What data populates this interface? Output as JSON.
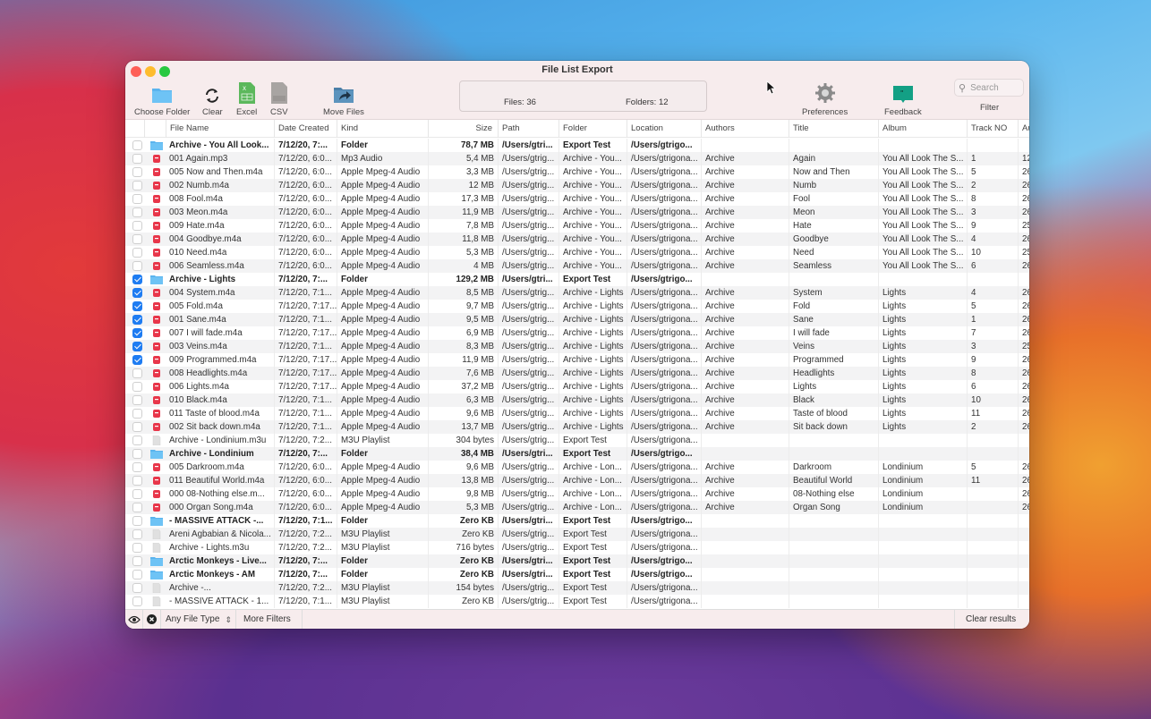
{
  "window": {
    "title": "File List Export"
  },
  "toolbar": {
    "choose_folder": "Choose Folder",
    "clear": "Clear",
    "excel": "Excel",
    "csv": "CSV",
    "csv_icon_text": "CSV",
    "move_files": "Move Files",
    "preferences": "Preferences",
    "feedback": "Feedback",
    "filter": "Filter",
    "search_placeholder": "Search"
  },
  "summary": {
    "files": "Files: 36",
    "folders": "Folders: 12"
  },
  "columns": [
    "",
    "",
    "File Name",
    "Date Created",
    "Kind",
    "Size",
    "Path",
    "Folder",
    "Location",
    "Authors",
    "Title",
    "Album",
    "Track NO",
    "Au"
  ],
  "rows": [
    {
      "checked": false,
      "type": "folder",
      "bold": true,
      "name": "Archive - You All Look...",
      "date": "7/12/20, 7:...",
      "kind": "Folder",
      "size": "78,7 MB",
      "path": "/Users/gtri...",
      "folder": "Export Test",
      "location": "/Users/gtrigo...",
      "authors": "",
      "title": "",
      "album": "",
      "track": "",
      "au": ""
    },
    {
      "checked": false,
      "type": "audio",
      "bold": false,
      "name": "001 Again.mp3",
      "date": "7/12/20, 6:0...",
      "kind": "Mp3 Audio",
      "size": "5,4 MB",
      "path": "/Users/gtrig...",
      "folder": "Archive - You...",
      "location": "/Users/gtrigona...",
      "authors": "Archive",
      "title": "Again",
      "album": "You All Look The S...",
      "track": "1",
      "au": "12"
    },
    {
      "checked": false,
      "type": "audio",
      "bold": false,
      "name": "005 Now and Then.m4a",
      "date": "7/12/20, 6:0...",
      "kind": "Apple Mpeg-4 Audio",
      "size": "3,3 MB",
      "path": "/Users/gtrig...",
      "folder": "Archive - You...",
      "location": "/Users/gtrigona...",
      "authors": "Archive",
      "title": "Now and Then",
      "album": "You All Look The S...",
      "track": "5",
      "au": "26"
    },
    {
      "checked": false,
      "type": "audio",
      "bold": false,
      "name": "002 Numb.m4a",
      "date": "7/12/20, 6:0...",
      "kind": "Apple Mpeg-4 Audio",
      "size": "12 MB",
      "path": "/Users/gtrig...",
      "folder": "Archive - You...",
      "location": "/Users/gtrigona...",
      "authors": "Archive",
      "title": "Numb",
      "album": "You All Look The S...",
      "track": "2",
      "au": "26"
    },
    {
      "checked": false,
      "type": "audio",
      "bold": false,
      "name": "008 Fool.m4a",
      "date": "7/12/20, 6:0...",
      "kind": "Apple Mpeg-4 Audio",
      "size": "17,3 MB",
      "path": "/Users/gtrig...",
      "folder": "Archive - You...",
      "location": "/Users/gtrigona...",
      "authors": "Archive",
      "title": "Fool",
      "album": "You All Look The S...",
      "track": "8",
      "au": "26"
    },
    {
      "checked": false,
      "type": "audio",
      "bold": false,
      "name": "003 Meon.m4a",
      "date": "7/12/20, 6:0...",
      "kind": "Apple Mpeg-4 Audio",
      "size": "11,9 MB",
      "path": "/Users/gtrig...",
      "folder": "Archive - You...",
      "location": "/Users/gtrigona...",
      "authors": "Archive",
      "title": "Meon",
      "album": "You All Look The S...",
      "track": "3",
      "au": "26"
    },
    {
      "checked": false,
      "type": "audio",
      "bold": false,
      "name": "009 Hate.m4a",
      "date": "7/12/20, 6:0...",
      "kind": "Apple Mpeg-4 Audio",
      "size": "7,8 MB",
      "path": "/Users/gtrig...",
      "folder": "Archive - You...",
      "location": "/Users/gtrigona...",
      "authors": "Archive",
      "title": "Hate",
      "album": "You All Look The S...",
      "track": "9",
      "au": "25"
    },
    {
      "checked": false,
      "type": "audio",
      "bold": false,
      "name": "004 Goodbye.m4a",
      "date": "7/12/20, 6:0...",
      "kind": "Apple Mpeg-4 Audio",
      "size": "11,8 MB",
      "path": "/Users/gtrig...",
      "folder": "Archive - You...",
      "location": "/Users/gtrigona...",
      "authors": "Archive",
      "title": "Goodbye",
      "album": "You All Look The S...",
      "track": "4",
      "au": "26"
    },
    {
      "checked": false,
      "type": "audio",
      "bold": false,
      "name": "010 Need.m4a",
      "date": "7/12/20, 6:0...",
      "kind": "Apple Mpeg-4 Audio",
      "size": "5,3 MB",
      "path": "/Users/gtrig...",
      "folder": "Archive - You...",
      "location": "/Users/gtrigona...",
      "authors": "Archive",
      "title": "Need",
      "album": "You All Look The S...",
      "track": "10",
      "au": "25"
    },
    {
      "checked": false,
      "type": "audio",
      "bold": false,
      "name": "006 Seamless.m4a",
      "date": "7/12/20, 6:0...",
      "kind": "Apple Mpeg-4 Audio",
      "size": "4 MB",
      "path": "/Users/gtrig...",
      "folder": "Archive - You...",
      "location": "/Users/gtrigona...",
      "authors": "Archive",
      "title": "Seamless",
      "album": "You All Look The S...",
      "track": "6",
      "au": "26"
    },
    {
      "checked": true,
      "type": "folder",
      "bold": true,
      "name": "Archive - Lights",
      "date": "7/12/20, 7:...",
      "kind": "Folder",
      "size": "129,2 MB",
      "path": "/Users/gtri...",
      "folder": "Export Test",
      "location": "/Users/gtrigo...",
      "authors": "",
      "title": "",
      "album": "",
      "track": "",
      "au": ""
    },
    {
      "checked": true,
      "type": "audio",
      "bold": false,
      "name": "004 System.m4a",
      "date": "7/12/20, 7:1...",
      "kind": "Apple Mpeg-4 Audio",
      "size": "8,5 MB",
      "path": "/Users/gtrig...",
      "folder": "Archive - Lights",
      "location": "/Users/gtrigona...",
      "authors": "Archive",
      "title": "System",
      "album": "Lights",
      "track": "4",
      "au": "26"
    },
    {
      "checked": true,
      "type": "audio",
      "bold": false,
      "name": "005 Fold.m4a",
      "date": "7/12/20, 7:17...",
      "kind": "Apple Mpeg-4 Audio",
      "size": "9,7 MB",
      "path": "/Users/gtrig...",
      "folder": "Archive - Lights",
      "location": "/Users/gtrigona...",
      "authors": "Archive",
      "title": "Fold",
      "album": "Lights",
      "track": "5",
      "au": "26"
    },
    {
      "checked": true,
      "type": "audio",
      "bold": false,
      "name": "001 Sane.m4a",
      "date": "7/12/20, 7:1...",
      "kind": "Apple Mpeg-4 Audio",
      "size": "9,5 MB",
      "path": "/Users/gtrig...",
      "folder": "Archive - Lights",
      "location": "/Users/gtrigona...",
      "authors": "Archive",
      "title": "Sane",
      "album": "Lights",
      "track": "1",
      "au": "26"
    },
    {
      "checked": true,
      "type": "audio",
      "bold": false,
      "name": "007 I will fade.m4a",
      "date": "7/12/20, 7:17...",
      "kind": "Apple Mpeg-4 Audio",
      "size": "6,9 MB",
      "path": "/Users/gtrig...",
      "folder": "Archive - Lights",
      "location": "/Users/gtrigona...",
      "authors": "Archive",
      "title": "I will fade",
      "album": "Lights",
      "track": "7",
      "au": "26"
    },
    {
      "checked": true,
      "type": "audio",
      "bold": false,
      "name": "003 Veins.m4a",
      "date": "7/12/20, 7:1...",
      "kind": "Apple Mpeg-4 Audio",
      "size": "8,3 MB",
      "path": "/Users/gtrig...",
      "folder": "Archive - Lights",
      "location": "/Users/gtrigona...",
      "authors": "Archive",
      "title": "Veins",
      "album": "Lights",
      "track": "3",
      "au": "25"
    },
    {
      "checked": true,
      "type": "audio",
      "bold": false,
      "name": "009 Programmed.m4a",
      "date": "7/12/20, 7:17...",
      "kind": "Apple Mpeg-4 Audio",
      "size": "11,9 MB",
      "path": "/Users/gtrig...",
      "folder": "Archive - Lights",
      "location": "/Users/gtrigona...",
      "authors": "Archive",
      "title": "Programmed",
      "album": "Lights",
      "track": "9",
      "au": "26"
    },
    {
      "checked": false,
      "type": "audio",
      "bold": false,
      "name": "008 Headlights.m4a",
      "date": "7/12/20, 7:17...",
      "kind": "Apple Mpeg-4 Audio",
      "size": "7,6 MB",
      "path": "/Users/gtrig...",
      "folder": "Archive - Lights",
      "location": "/Users/gtrigona...",
      "authors": "Archive",
      "title": "Headlights",
      "album": "Lights",
      "track": "8",
      "au": "26"
    },
    {
      "checked": false,
      "type": "audio",
      "bold": false,
      "name": "006 Lights.m4a",
      "date": "7/12/20, 7:17...",
      "kind": "Apple Mpeg-4 Audio",
      "size": "37,2 MB",
      "path": "/Users/gtrig...",
      "folder": "Archive - Lights",
      "location": "/Users/gtrigona...",
      "authors": "Archive",
      "title": "Lights",
      "album": "Lights",
      "track": "6",
      "au": "26"
    },
    {
      "checked": false,
      "type": "audio",
      "bold": false,
      "name": "010 Black.m4a",
      "date": "7/12/20, 7:1...",
      "kind": "Apple Mpeg-4 Audio",
      "size": "6,3 MB",
      "path": "/Users/gtrig...",
      "folder": "Archive - Lights",
      "location": "/Users/gtrigona...",
      "authors": "Archive",
      "title": "Black",
      "album": "Lights",
      "track": "10",
      "au": "26"
    },
    {
      "checked": false,
      "type": "audio",
      "bold": false,
      "name": "011 Taste of blood.m4a",
      "date": "7/12/20, 7:1...",
      "kind": "Apple Mpeg-4 Audio",
      "size": "9,6 MB",
      "path": "/Users/gtrig...",
      "folder": "Archive - Lights",
      "location": "/Users/gtrigona...",
      "authors": "Archive",
      "title": "Taste of blood",
      "album": "Lights",
      "track": "11",
      "au": "26"
    },
    {
      "checked": false,
      "type": "audio",
      "bold": false,
      "name": "002 Sit back down.m4a",
      "date": "7/12/20, 7:1...",
      "kind": "Apple Mpeg-4 Audio",
      "size": "13,7 MB",
      "path": "/Users/gtrig...",
      "folder": "Archive - Lights",
      "location": "/Users/gtrigona...",
      "authors": "Archive",
      "title": "Sit back down",
      "album": "Lights",
      "track": "2",
      "au": "26"
    },
    {
      "checked": false,
      "type": "doc",
      "bold": false,
      "name": "Archive - Londinium.m3u",
      "date": "7/12/20, 7:2...",
      "kind": "M3U Playlist",
      "size": "304 bytes",
      "path": "/Users/gtrig...",
      "folder": "Export Test",
      "location": "/Users/gtrigona...",
      "authors": "",
      "title": "",
      "album": "",
      "track": "",
      "au": ""
    },
    {
      "checked": false,
      "type": "folder",
      "bold": true,
      "name": "Archive - Londinium",
      "date": "7/12/20, 7:...",
      "kind": "Folder",
      "size": "38,4 MB",
      "path": "/Users/gtri...",
      "folder": "Export Test",
      "location": "/Users/gtrigo...",
      "authors": "",
      "title": "",
      "album": "",
      "track": "",
      "au": ""
    },
    {
      "checked": false,
      "type": "audio",
      "bold": false,
      "name": "005 Darkroom.m4a",
      "date": "7/12/20, 6:0...",
      "kind": "Apple Mpeg-4 Audio",
      "size": "9,6 MB",
      "path": "/Users/gtrig...",
      "folder": "Archive - Lon...",
      "location": "/Users/gtrigona...",
      "authors": "Archive",
      "title": "Darkroom",
      "album": "Londinium",
      "track": "5",
      "au": "26"
    },
    {
      "checked": false,
      "type": "audio",
      "bold": false,
      "name": "011 Beautiful World.m4a",
      "date": "7/12/20, 6:0...",
      "kind": "Apple Mpeg-4 Audio",
      "size": "13,8 MB",
      "path": "/Users/gtrig...",
      "folder": "Archive - Lon...",
      "location": "/Users/gtrigona...",
      "authors": "Archive",
      "title": "Beautiful World",
      "album": "Londinium",
      "track": "11",
      "au": "26"
    },
    {
      "checked": false,
      "type": "audio",
      "bold": false,
      "name": "000 08-Nothing else.m...",
      "date": "7/12/20, 6:0...",
      "kind": "Apple Mpeg-4 Audio",
      "size": "9,8 MB",
      "path": "/Users/gtrig...",
      "folder": "Archive - Lon...",
      "location": "/Users/gtrigona...",
      "authors": "Archive",
      "title": "08-Nothing else",
      "album": "Londinium",
      "track": "",
      "au": "26"
    },
    {
      "checked": false,
      "type": "audio",
      "bold": false,
      "name": "000 Organ Song.m4a",
      "date": "7/12/20, 6:0...",
      "kind": "Apple Mpeg-4 Audio",
      "size": "5,3 MB",
      "path": "/Users/gtrig...",
      "folder": "Archive - Lon...",
      "location": "/Users/gtrigona...",
      "authors": "Archive",
      "title": "Organ Song",
      "album": "Londinium",
      "track": "",
      "au": "26"
    },
    {
      "checked": false,
      "type": "folder",
      "bold": true,
      "name": " - MASSIVE ATTACK -...",
      "date": "7/12/20, 7:1...",
      "kind": "Folder",
      "size": "Zero KB",
      "path": "/Users/gtri...",
      "folder": "Export Test",
      "location": "/Users/gtrigo...",
      "authors": "",
      "title": "",
      "album": "",
      "track": "",
      "au": ""
    },
    {
      "checked": false,
      "type": "doc",
      "bold": false,
      "name": "Areni Agbabian & Nicola...",
      "date": "7/12/20, 7:2...",
      "kind": "M3U Playlist",
      "size": "Zero KB",
      "path": "/Users/gtrig...",
      "folder": "Export Test",
      "location": "/Users/gtrigona...",
      "authors": "",
      "title": "",
      "album": "",
      "track": "",
      "au": ""
    },
    {
      "checked": false,
      "type": "doc",
      "bold": false,
      "name": "Archive - Lights.m3u",
      "date": "7/12/20, 7:2...",
      "kind": "M3U Playlist",
      "size": "716 bytes",
      "path": "/Users/gtrig...",
      "folder": "Export Test",
      "location": "/Users/gtrigona...",
      "authors": "",
      "title": "",
      "album": "",
      "track": "",
      "au": ""
    },
    {
      "checked": false,
      "type": "folder",
      "bold": true,
      "name": "Arctic Monkeys - Live...",
      "date": "7/12/20, 7:...",
      "kind": "Folder",
      "size": "Zero KB",
      "path": "/Users/gtri...",
      "folder": "Export Test",
      "location": "/Users/gtrigo...",
      "authors": "",
      "title": "",
      "album": "",
      "track": "",
      "au": ""
    },
    {
      "checked": false,
      "type": "folder",
      "bold": true,
      "name": "Arctic Monkeys - AM",
      "date": "7/12/20, 7:...",
      "kind": "Folder",
      "size": "Zero KB",
      "path": "/Users/gtri...",
      "folder": "Export Test",
      "location": "/Users/gtrigo...",
      "authors": "",
      "title": "",
      "album": "",
      "track": "",
      "au": ""
    },
    {
      "checked": false,
      "type": "doc",
      "bold": false,
      "name": "Archive              -...",
      "date": "7/12/20, 7:2...",
      "kind": "M3U Playlist",
      "size": "154 bytes",
      "path": "/Users/gtrig...",
      "folder": "Export Test",
      "location": "/Users/gtrigona...",
      "authors": "",
      "title": "",
      "album": "",
      "track": "",
      "au": ""
    },
    {
      "checked": false,
      "type": "doc",
      "bold": false,
      "name": " - MASSIVE ATTACK - 1...",
      "date": "7/12/20, 7:1...",
      "kind": "M3U Playlist",
      "size": "Zero KB",
      "path": "/Users/gtrig...",
      "folder": "Export Test",
      "location": "/Users/gtrigona...",
      "authors": "",
      "title": "",
      "album": "",
      "track": "",
      "au": ""
    }
  ],
  "footer": {
    "file_type_select": "Any File Type",
    "more_filters": "More Filters",
    "clear_results": "Clear results"
  },
  "colors": {
    "accent": "#1e7cf2",
    "folder": "#5ab4ee",
    "audio": "#e8364a",
    "excel": "#5cb85c",
    "feedback": "#13a085"
  }
}
